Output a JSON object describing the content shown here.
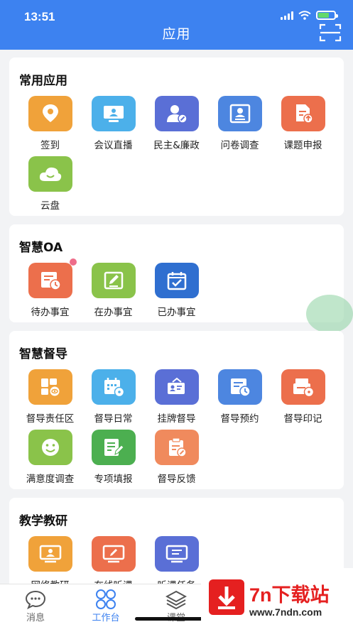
{
  "status_bar": {
    "time": "13:51"
  },
  "header": {
    "title": "应用"
  },
  "sections": {
    "common": {
      "title": "常用应用",
      "apps": [
        {
          "label": "签到",
          "icon": "location-pin-icon",
          "color": "#f0a23a"
        },
        {
          "label": "会议直播",
          "icon": "monitor-icon",
          "color": "#4cb0ea"
        },
        {
          "label": "民主&廉政",
          "icon": "user-edit-icon",
          "color": "#5a6fd6"
        },
        {
          "label": "问卷调查",
          "icon": "id-card-icon",
          "color": "#4d86e0"
        },
        {
          "label": "课题申报",
          "icon": "document-upload-icon",
          "color": "#ec6f4c"
        },
        {
          "label": "云盘",
          "icon": "cloud-icon",
          "color": "#8ac34a"
        }
      ]
    },
    "oa": {
      "title": "智慧OA",
      "apps": [
        {
          "label": "待办事宜",
          "icon": "document-clock-icon",
          "color": "#ec6f4c"
        },
        {
          "label": "在办事宜",
          "icon": "edit-icon",
          "color": "#8ac34a"
        },
        {
          "label": "已办事宜",
          "icon": "calendar-check-icon",
          "color": "#2f6fd0"
        }
      ]
    },
    "supervision": {
      "title": "智慧督导",
      "apps": [
        {
          "label": "督导责任区",
          "icon": "grid-eye-icon",
          "color": "#f0a23a"
        },
        {
          "label": "督导日常",
          "icon": "calendar-eye-icon",
          "color": "#4cb0ea"
        },
        {
          "label": "挂牌督导",
          "icon": "badge-icon",
          "color": "#5a6fd6"
        },
        {
          "label": "督导预约",
          "icon": "list-clock-icon",
          "color": "#4d86e0"
        },
        {
          "label": "督导印记",
          "icon": "printer-eye-icon",
          "color": "#ec6f4c"
        },
        {
          "label": "满意度调查",
          "icon": "smile-icon",
          "color": "#8ac34a"
        },
        {
          "label": "专项填报",
          "icon": "form-edit-icon",
          "color": "#4caf50"
        },
        {
          "label": "督导反馈",
          "icon": "clipboard-edit-icon",
          "color": "#f08a5d"
        }
      ]
    },
    "teaching": {
      "title": "教学教研",
      "apps": [
        {
          "label": "网络教研",
          "icon": "screen-person-icon",
          "color": "#f0a23a"
        },
        {
          "label": "在线听课",
          "icon": "screen-pen-icon",
          "color": "#ec6f4c"
        },
        {
          "label": "听课任务",
          "icon": "screen-list-icon",
          "color": "#5a6fd6"
        }
      ]
    }
  },
  "tabbar": [
    {
      "label": "消息",
      "icon": "chat-bubble-icon"
    },
    {
      "label": "工作台",
      "icon": "grid-icon",
      "active": true
    },
    {
      "label": "课堂",
      "icon": "layers-icon"
    }
  ],
  "watermark": {
    "title": "7n下载站",
    "url": "www.7ndn.com"
  },
  "colors": {
    "primary": "#3d82f0",
    "badge": "#ee6d8a"
  }
}
